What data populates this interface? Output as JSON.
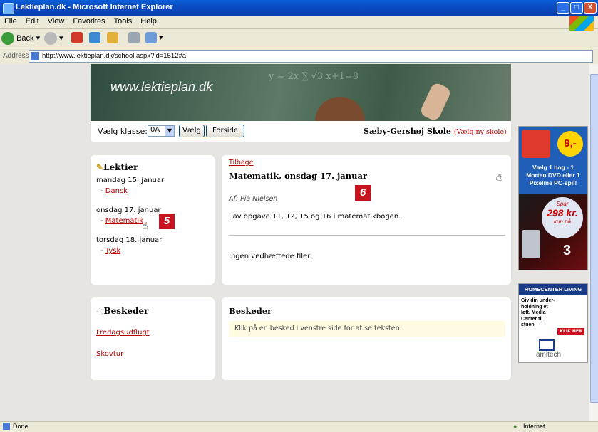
{
  "window": {
    "title": "Lektieplan.dk - Microsoft Internet Explorer",
    "minimize": "_",
    "maximize": "□",
    "close": "X"
  },
  "menu": [
    "File",
    "Edit",
    "View",
    "Favorites",
    "Tools",
    "Help"
  ],
  "toolbar": {
    "back_label": "Back"
  },
  "address": {
    "label": "Address",
    "url": "http://www.lektieplan.dk/school.aspx?id=1512#a"
  },
  "banner": {
    "site": "www.lektieplan.dk",
    "chalk": "y = 2x  ∑  √3  x+1=8"
  },
  "classbar": {
    "label": "Vælg klasse:",
    "selected_class": "0A",
    "vaelg_button": "Vælg",
    "forside_button": "Forside",
    "school_name": "Sæby-Gershøj Skole",
    "change_school": "(Vælg ny skole)"
  },
  "lektier": {
    "heading": "Lektier",
    "days": [
      {
        "date": "mandag 15. januar",
        "subject": "Dansk"
      },
      {
        "date": "onsdag 17. januar",
        "subject": "Matematik"
      },
      {
        "date": "torsdag 18. januar",
        "subject": "Tysk"
      }
    ]
  },
  "lesson": {
    "back_link": "Tilbage",
    "title": "Matematik, onsdag 17. januar",
    "author": "Af: Pia Nielsen",
    "body": "Lav opgave 11, 12, 15 og 16 i matematikbogen.",
    "attachments": "Ingen vedhæftede filer."
  },
  "beskeder_left": {
    "heading": "Beskeder",
    "items": [
      "Fredagsudflugt",
      "Skovtur"
    ]
  },
  "beskeder_right": {
    "heading": "Beskeder",
    "hint": "Klik på en besked i venstre side for at se teksten."
  },
  "badges": {
    "five": "5",
    "six": "6"
  },
  "ads": {
    "ad1": {
      "price": "9,-",
      "text": "Vælg 1 bog - 1 Morten DVD eller 1 Pixeline PC-spil!"
    },
    "ad2": {
      "line1": "Spar",
      "amount": "298 kr.",
      "line2": "kun på",
      "brand": "3"
    },
    "ad3": {
      "header": "HOMECENTER LIVING",
      "text": "Giv din under-holdning et løft. Media Center til stuen",
      "button": "KLIK HER",
      "brand": "amitech"
    }
  },
  "status": {
    "left": "Done",
    "zone": "Internet"
  },
  "colors": {
    "link": "#bb0000",
    "badge": "#C8141E",
    "hint_bg": "#FFFBE0"
  }
}
